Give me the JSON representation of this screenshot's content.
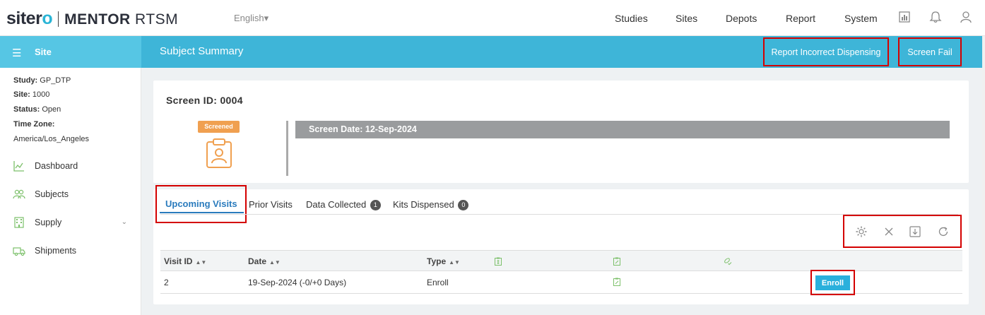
{
  "app": {
    "brand_left": "siter",
    "brand_o": "o",
    "product_bold": "MENTOR",
    "product_light": " RTSM",
    "language": "English▾"
  },
  "nav": {
    "items": [
      "Studies",
      "Sites",
      "Depots",
      "Report",
      "System"
    ],
    "icons": [
      "report-chart-icon",
      "bell-icon",
      "user-icon"
    ]
  },
  "sidebar": {
    "header": "Site",
    "study_label": "Study:",
    "study_value": "GP_DTP",
    "site_label": "Site:",
    "site_value": "1000",
    "status_label": "Status:",
    "status_value": "Open",
    "tz_label": "Time Zone:",
    "tz_value": "America/Los_Angeles",
    "menu": [
      {
        "label": "Dashboard",
        "icon": "chart-line-icon"
      },
      {
        "label": "Subjects",
        "icon": "users-icon"
      },
      {
        "label": "Supply",
        "icon": "building-icon"
      },
      {
        "label": "Shipments",
        "icon": "truck-icon"
      }
    ]
  },
  "header": {
    "title": "Subject Summary",
    "btn_report": "Report Incorrect Dispensing",
    "btn_screen_fail": "Screen Fail"
  },
  "subject": {
    "screen_id": "Screen ID: 0004",
    "status_badge": "Screened",
    "screen_date": "Screen Date: 12-Sep-2024"
  },
  "tabs": {
    "upcoming": "Upcoming Visits",
    "prior": "Prior Visits",
    "data_collected": "Data Collected",
    "data_collected_count": "1",
    "kits_dispensed": "Kits Dispensed",
    "kits_dispensed_count": "0"
  },
  "table": {
    "columns": [
      "Visit ID",
      "Date",
      "Type"
    ],
    "rows": [
      {
        "visit_id": "2",
        "date": "19-Sep-2024 (-0/+0 Days)",
        "type": "Enroll",
        "action": "Enroll"
      }
    ]
  },
  "colors": {
    "accent": "#3eb5d8",
    "sidebar_header": "#56c6e4",
    "screened_badge": "#f0a050",
    "highlight": "#d40000",
    "tab_active": "#2a7bbd"
  }
}
